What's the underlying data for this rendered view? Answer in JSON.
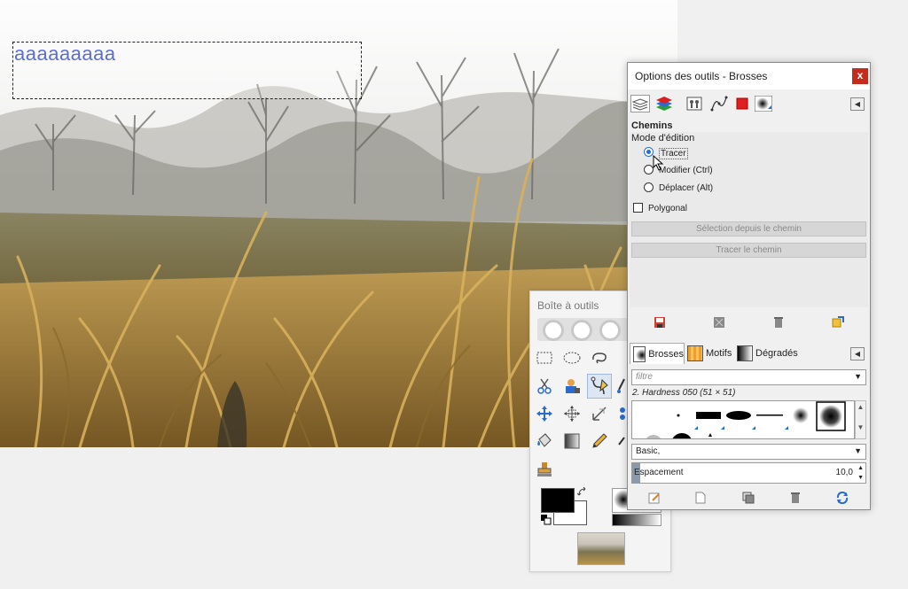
{
  "canvas": {
    "text_layer": "aaaaaaaaa"
  },
  "toolbox": {
    "title": "Boîte à outils",
    "tools": [
      "rect-select-icon",
      "ellipse-select-icon",
      "lasso-icon",
      "scissors-icon",
      "fg-select-icon",
      "paths-icon",
      "move-icon",
      "align-icon",
      "crop-icon",
      "bucket-fill-icon",
      "gradient-icon",
      "pencil-icon",
      "clone-icon"
    ],
    "active_tool": "paths-icon"
  },
  "dialog": {
    "title": "Options des outils - Brosses",
    "close_label": "x",
    "section_title": "Chemins",
    "mode_label": "Mode d'édition",
    "modes": [
      {
        "label": "Tracer",
        "selected": true
      },
      {
        "label": "Modifier (Ctrl)",
        "selected": false
      },
      {
        "label": "Déplacer (Alt)",
        "selected": false
      }
    ],
    "polygonal_label": "Polygonal",
    "polygonal_checked": false,
    "selection_from_path": "Sélection depuis le chemin",
    "stroke_path": "Tracer le chemin",
    "resource_tabs": [
      {
        "label": "Brosses",
        "selected": true
      },
      {
        "label": "Motifs",
        "selected": false
      },
      {
        "label": "Dégradés",
        "selected": false
      }
    ],
    "filter_placeholder": "filtre",
    "brush_name": "2. Hardness 050 (51 × 51)",
    "brush_set": "Basic,",
    "spacing_label": "Espacement",
    "spacing_value": "10,0"
  },
  "colors": {
    "accent": "#1f6fd6",
    "close": "#c42b1c",
    "text_layer": "#5b6ed6"
  }
}
